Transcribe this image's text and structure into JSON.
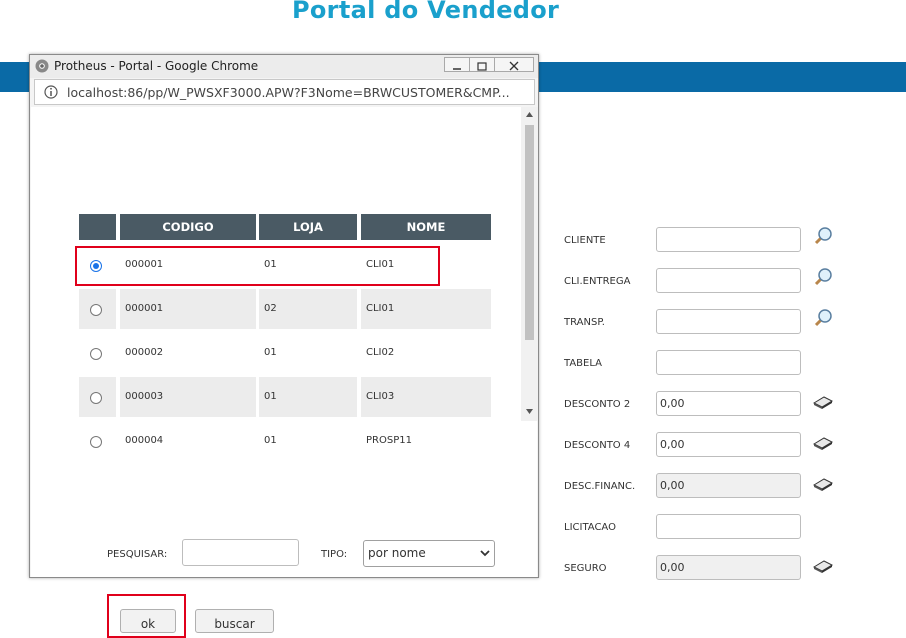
{
  "header": {
    "title": "Portal do Vendedor"
  },
  "popup": {
    "window_title": "Protheus - Portal - Google Chrome",
    "url": "localhost:86/pp/W_PWSXF3000.APW?F3Nome=BRWCUSTOMER&CMP...",
    "table": {
      "columns": [
        "CODIGO",
        "LOJA",
        "NOME"
      ],
      "rows": [
        {
          "codigo": "000001",
          "loja": "01",
          "nome": "CLI01",
          "selected": true
        },
        {
          "codigo": "000001",
          "loja": "02",
          "nome": "CLI01",
          "selected": false
        },
        {
          "codigo": "000002",
          "loja": "01",
          "nome": "CLI02",
          "selected": false
        },
        {
          "codigo": "000003",
          "loja": "01",
          "nome": "CLI03",
          "selected": false
        },
        {
          "codigo": "000004",
          "loja": "01",
          "nome": "PROSP11",
          "selected": false
        }
      ]
    },
    "search": {
      "label": "PESQUISAR:",
      "value": ""
    },
    "tipo": {
      "label": "TIPO:",
      "selected": "por nome"
    },
    "buttons": {
      "ok": "ok",
      "buscar": "buscar"
    }
  },
  "form": {
    "fields": [
      {
        "label": "CLIENTE",
        "value": "",
        "icon": "magnifier-icon"
      },
      {
        "label": "CLI.ENTREGA",
        "value": "",
        "icon": "magnifier-icon"
      },
      {
        "label": "TRANSP.",
        "value": "",
        "icon": "magnifier-icon"
      },
      {
        "label": "TABELA",
        "value": "",
        "icon": ""
      },
      {
        "label": "DESCONTO 2",
        "value": "0,00",
        "icon": "calculator-icon"
      },
      {
        "label": "DESCONTO 4",
        "value": "0,00",
        "icon": "calculator-icon"
      },
      {
        "label": "DESC.FINANC.",
        "value": "0,00",
        "icon": "calculator-icon"
      },
      {
        "label": "LICITACAO",
        "value": "",
        "icon": ""
      },
      {
        "label": "SEGURO",
        "value": "0,00",
        "icon": "calculator-icon"
      }
    ]
  },
  "colors": {
    "title": "#1aa0cc",
    "header_bar": "#0a6aa6",
    "table_header": "#4a5a64",
    "highlight": "#e0001b",
    "radio_selected": "#1a73e8"
  }
}
